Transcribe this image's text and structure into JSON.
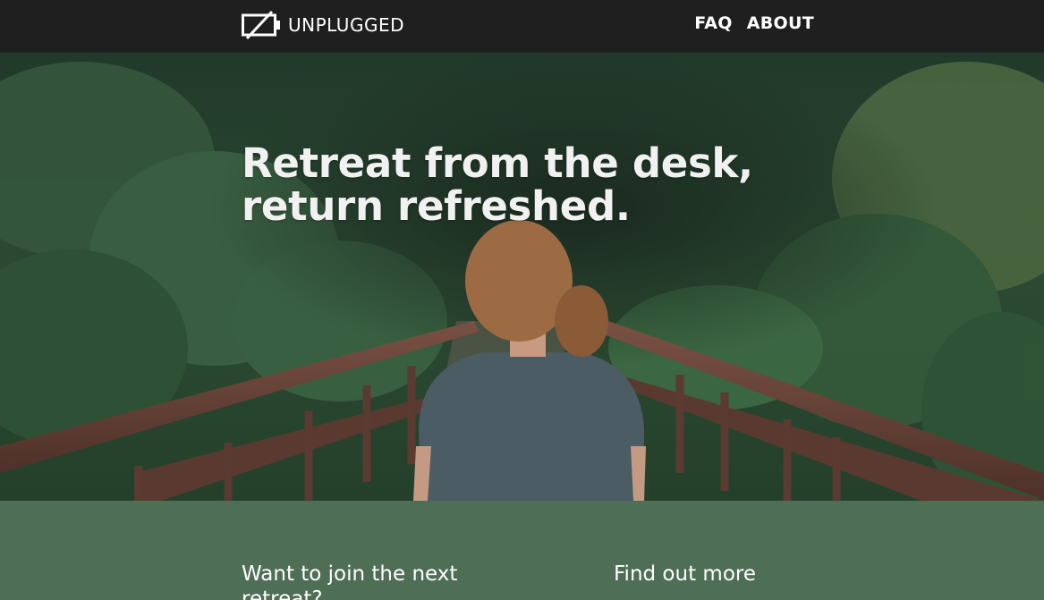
{
  "header": {
    "brand_name": "UNPLUGGED",
    "brand_icon": "unplugged-battery-icon",
    "nav": [
      {
        "label": "FAQ"
      },
      {
        "label": "ABOUT"
      }
    ]
  },
  "hero": {
    "title_line1": "Retreat from the desk,",
    "title_line2": "return refreshed.",
    "image": "woman-on-forest-bridge-photo"
  },
  "sections": {
    "join_title": "Want to join the next retreat?",
    "more_title": "Find out more"
  },
  "colors": {
    "header_bg": "#1f1f1f",
    "section_bg": "#4e6e56",
    "text": "#ffffff"
  }
}
